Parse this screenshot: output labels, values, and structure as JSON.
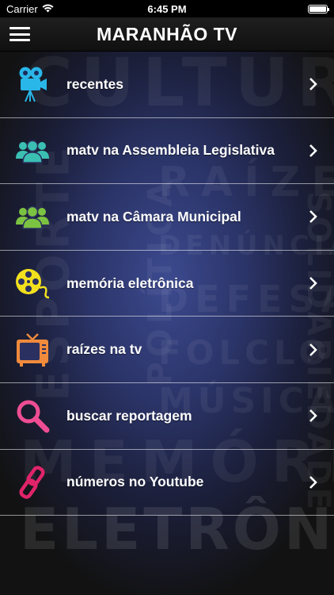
{
  "status_bar": {
    "carrier": "Carrier",
    "time": "6:45 PM",
    "battery_level": 1.0
  },
  "nav": {
    "title": "MARANHÃO TV",
    "menu_icon": "hamburger-menu-icon"
  },
  "background_words": [
    "CULTURA",
    "RAÍZES",
    "DENÚNCIA",
    "DEFESA",
    "FOLCLORE",
    "MÚSICA",
    "MEMÓRIA",
    "ELETRÔNICA",
    "ESPORTE",
    "POLÍTICA",
    "SOLIDARIEDADE"
  ],
  "menu": [
    {
      "label": "recentes",
      "icon": "movie-camera-icon",
      "icon_color": "#29b6e8"
    },
    {
      "label": "matv na Assembleia Legislativa",
      "icon": "group-teal-icon",
      "icon_color": "#3bbfb3"
    },
    {
      "label": "matv na Câmara Municipal",
      "icon": "group-green-icon",
      "icon_color": "#7cc242"
    },
    {
      "label": "memória eletrônica",
      "icon": "film-reel-icon",
      "icon_color": "#f2e01e"
    },
    {
      "label": "raízes na tv",
      "icon": "retro-tv-icon",
      "icon_color": "#f08a3c"
    },
    {
      "label": "buscar reportagem",
      "icon": "magnifier-icon",
      "icon_color": "#ee4d93"
    },
    {
      "label": "números no Youtube",
      "icon": "chain-link-icon",
      "icon_color": "#e0246a"
    }
  ]
}
